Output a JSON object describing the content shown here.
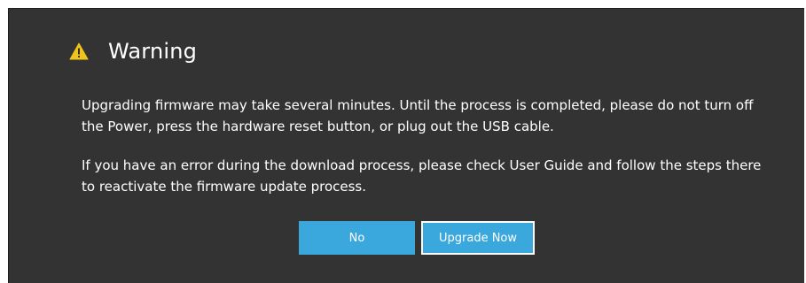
{
  "dialog": {
    "icon": "warning-triangle-icon",
    "title": "Warning",
    "paragraph1": "Upgrading firmware may take several minutes. Until the process is completed, please do not turn off the Power, press the hardware reset button, or plug out the USB cable.",
    "paragraph2": "If you have an error during the download process, please check User Guide and follow the steps there to reactivate the firmware update process.",
    "buttons": {
      "no_label": "No",
      "upgrade_label": "Upgrade Now"
    }
  },
  "colors": {
    "background": "#333333",
    "button": "#3aa7dd",
    "warning_icon": "#f0c419"
  }
}
